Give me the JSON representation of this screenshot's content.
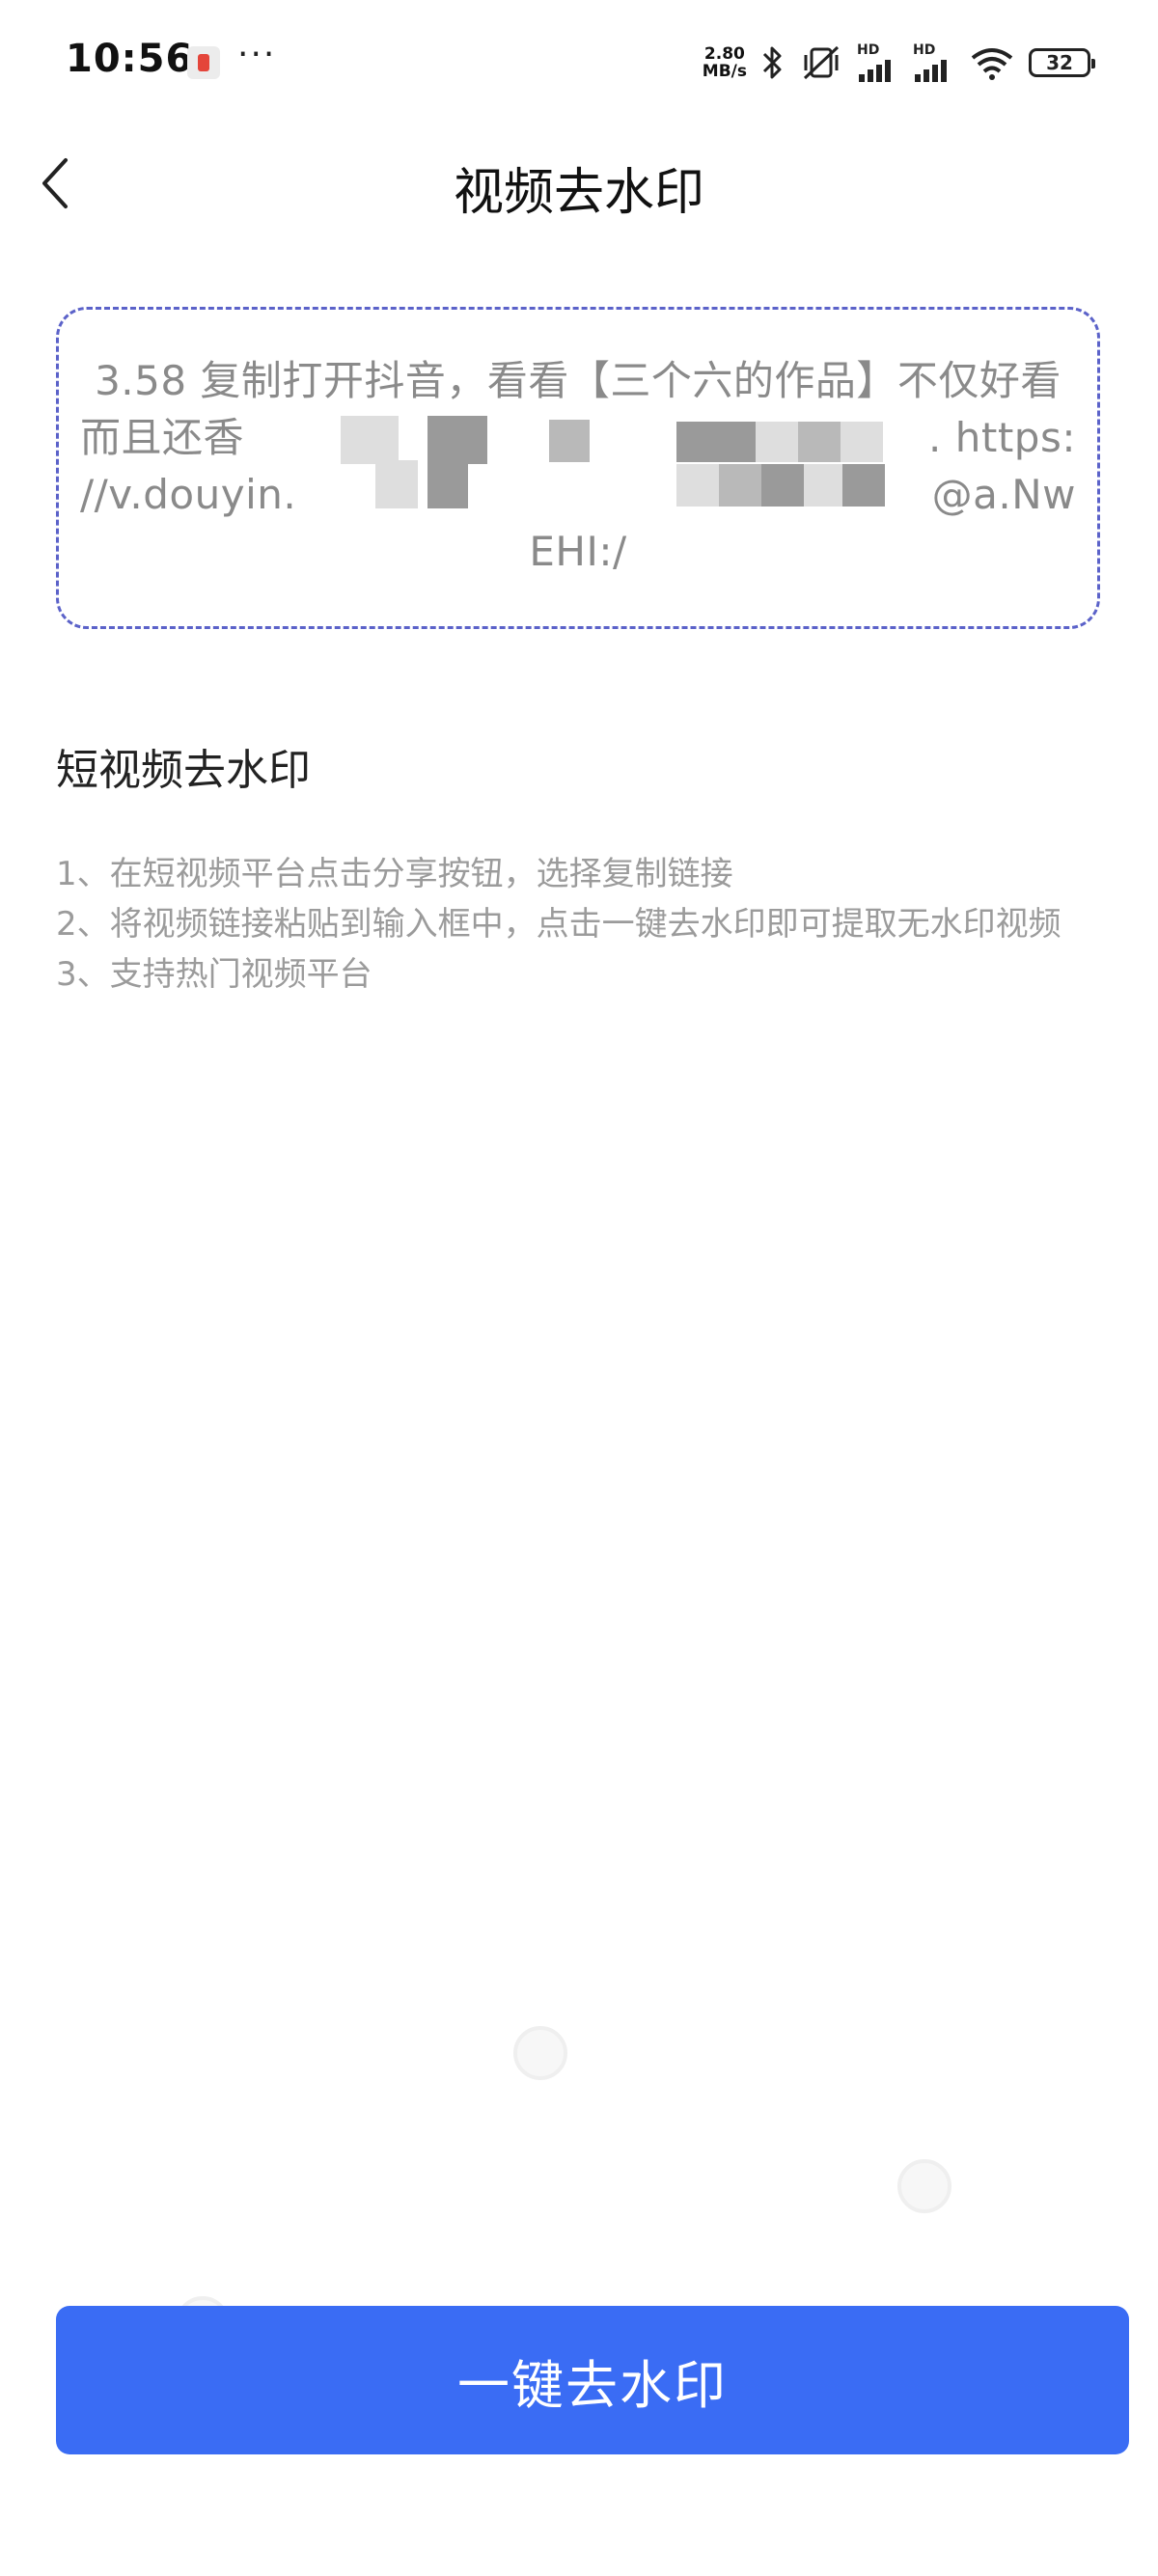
{
  "status_bar": {
    "time": "10:56",
    "more": "···",
    "net_speed_value": "2.80",
    "net_speed_unit": "MB/s",
    "signal_1_label": "HD",
    "signal_2_label": "HD",
    "battery": "32",
    "icons": [
      "notification-app-icon",
      "bluetooth-icon",
      "vibrate-mute-icon",
      "signal-icon",
      "signal-icon",
      "wifi-icon",
      "battery-icon"
    ]
  },
  "header": {
    "title": "视频去水印",
    "back_icon": "chevron-left-icon"
  },
  "input": {
    "text_line1": "3.58 复制打开抖音，看看【三个六的作品】不仅好看",
    "text_line2_start": "而且还香 ",
    "text_line2_end": ". https:",
    "text_line3_start": "//v.douyin.",
    "text_line3_end": "@a.Nw",
    "text_line4": "EHI:/",
    "border_color": "#5b62c9"
  },
  "section": {
    "title": "短视频去水印",
    "steps": [
      "1、在短视频平台点击分享按钮，选择复制链接",
      "2、将视频链接粘贴到输入框中，点击一键去水印即可提取无水印视频",
      "3、支持热门视频平台"
    ]
  },
  "action": {
    "label": "一键去水印",
    "color": "#3a6cf4"
  }
}
